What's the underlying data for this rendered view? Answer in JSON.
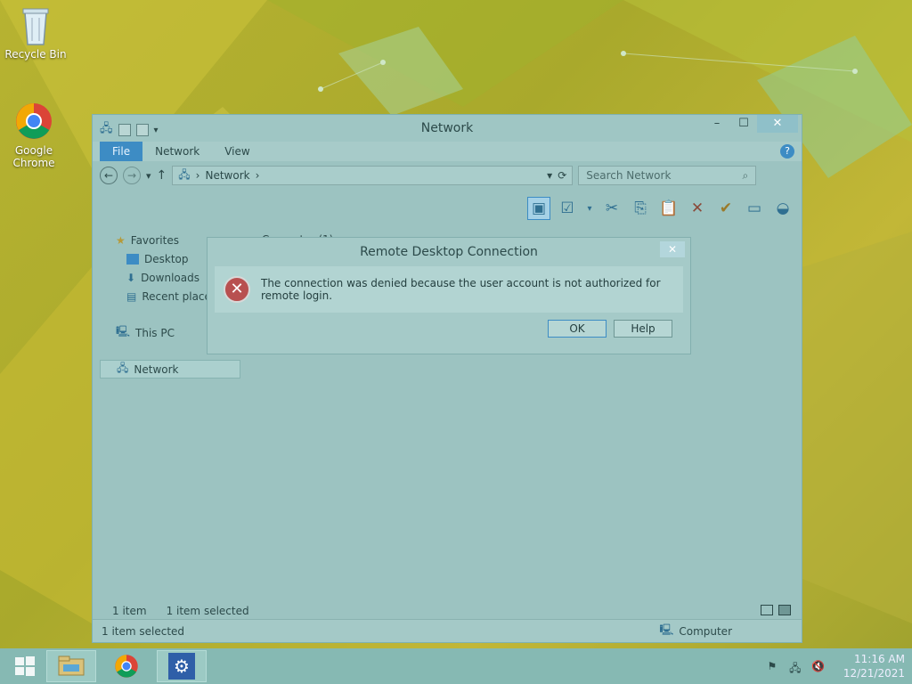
{
  "desktop": {
    "icons": [
      {
        "label": "Recycle Bin",
        "icon": "recycle-bin-icon"
      },
      {
        "label": "Google Chrome",
        "icon": "chrome-icon"
      }
    ]
  },
  "explorer": {
    "title": "Network",
    "ribbon_tabs": [
      "File",
      "Network",
      "View"
    ],
    "address_path": "Network",
    "search_placeholder": "Search Network",
    "content_heading": "Computer (1)",
    "sidebar": {
      "favorites": "Favorites",
      "desktop": "Desktop",
      "downloads": "Downloads",
      "recent": "Recent places",
      "this_pc": "This PC",
      "network": "Network"
    },
    "status_count": "1 item",
    "status_selected": "1 item selected",
    "details_selected": "1 item selected",
    "details_location": "Computer"
  },
  "dialog": {
    "title": "Remote Desktop Connection",
    "message": "The connection was denied because the user account is not authorized for remote login.",
    "ok_label": "OK",
    "help_label": "Help",
    "close_glyph": "✕"
  },
  "taskbar": {
    "time": "11:16 AM",
    "date": "12/21/2021"
  },
  "colors": {
    "accent": "#3d8cc4",
    "error": "#b85050"
  }
}
